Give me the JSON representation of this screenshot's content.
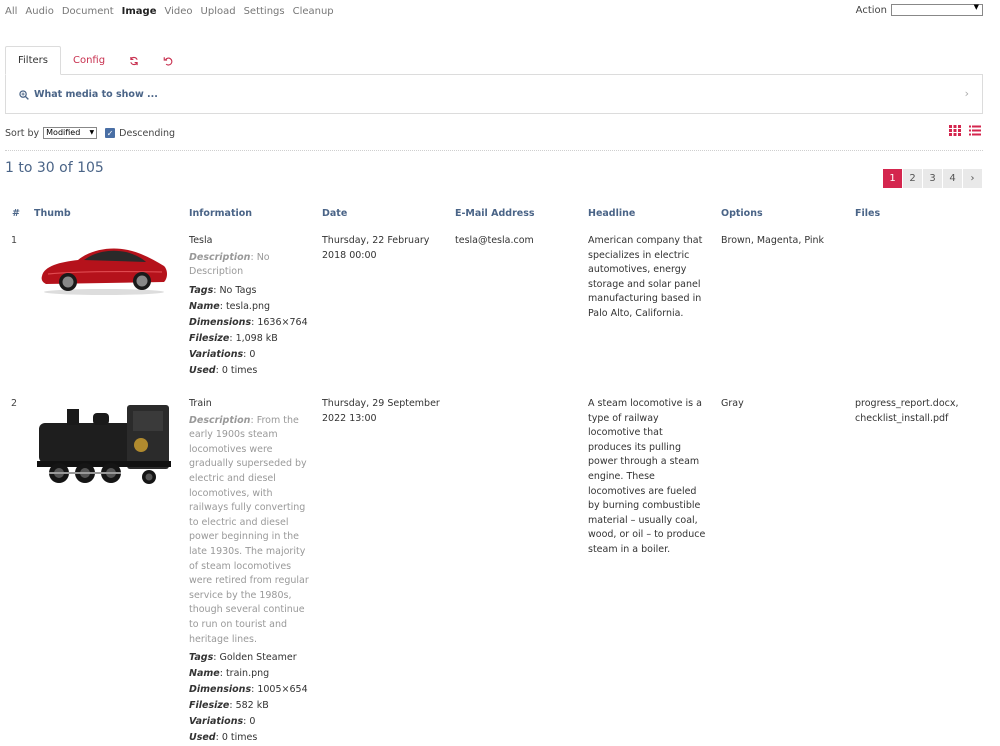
{
  "nav": {
    "items": [
      "All",
      "Audio",
      "Document",
      "Image",
      "Video",
      "Upload",
      "Settings",
      "Cleanup"
    ],
    "active": "Image"
  },
  "action": {
    "label": "Action",
    "value": ""
  },
  "tabs": {
    "filters": "Filters",
    "config": "Config"
  },
  "filter": {
    "what": "What media to show ..."
  },
  "sort": {
    "label": "Sort by",
    "value": "Modified",
    "descending": "Descending"
  },
  "count": "1 to 30 of 105",
  "pager": [
    "1",
    "2",
    "3",
    "4",
    "›"
  ],
  "columns": {
    "num": "#",
    "thumb": "Thumb",
    "info": "Information",
    "date": "Date",
    "email": "E-Mail Address",
    "headline": "Headline",
    "options": "Options",
    "files": "Files"
  },
  "labels": {
    "description": "Description",
    "tags": "Tags",
    "name": "Name",
    "dimensions": "Dimensions",
    "filesize": "Filesize",
    "variations": "Variations",
    "used": "Used"
  },
  "rows": [
    {
      "num": "1",
      "title": "Tesla",
      "description": "No Description",
      "tags": "No Tags",
      "name": "tesla.png",
      "dimensions": "1636×764",
      "filesize": "1,098 kB",
      "variations": "0",
      "used": "0 times",
      "date": "Thursday, 22 February 2018 00:00",
      "email": "tesla@tesla.com",
      "headline": "American company that specializes in electric automotives, energy storage and solar panel manufacturing based in Palo Alto, California.",
      "options": "Brown, Magenta, Pink",
      "files": ""
    },
    {
      "num": "2",
      "title": "Train",
      "description": "From the early 1900s steam locomotives were gradually superseded by electric and diesel locomotives, with railways fully converting to electric and diesel power beginning in the late 1930s. The majority of steam locomotives were retired from regular service by the 1980s, though several continue to run on tourist and heritage lines.",
      "tags": "Golden Steamer",
      "name": "train.png",
      "dimensions": "1005×654",
      "filesize": "582 kB",
      "variations": "0",
      "used": "0 times",
      "date": "Thursday, 29 September 2022 13:00",
      "email": "",
      "headline": "A steam locomotive is a type of railway locomotive that produces its pulling power through a steam engine. These locomotives are fueled by burning combustible material – usually coal, wood, or oil – to produce steam in a boiler.",
      "options": "Gray",
      "files": "progress_report.docx, checklist_install.pdf"
    }
  ],
  "colors": {
    "accent": "#d4264e",
    "link": "#4a6487"
  }
}
